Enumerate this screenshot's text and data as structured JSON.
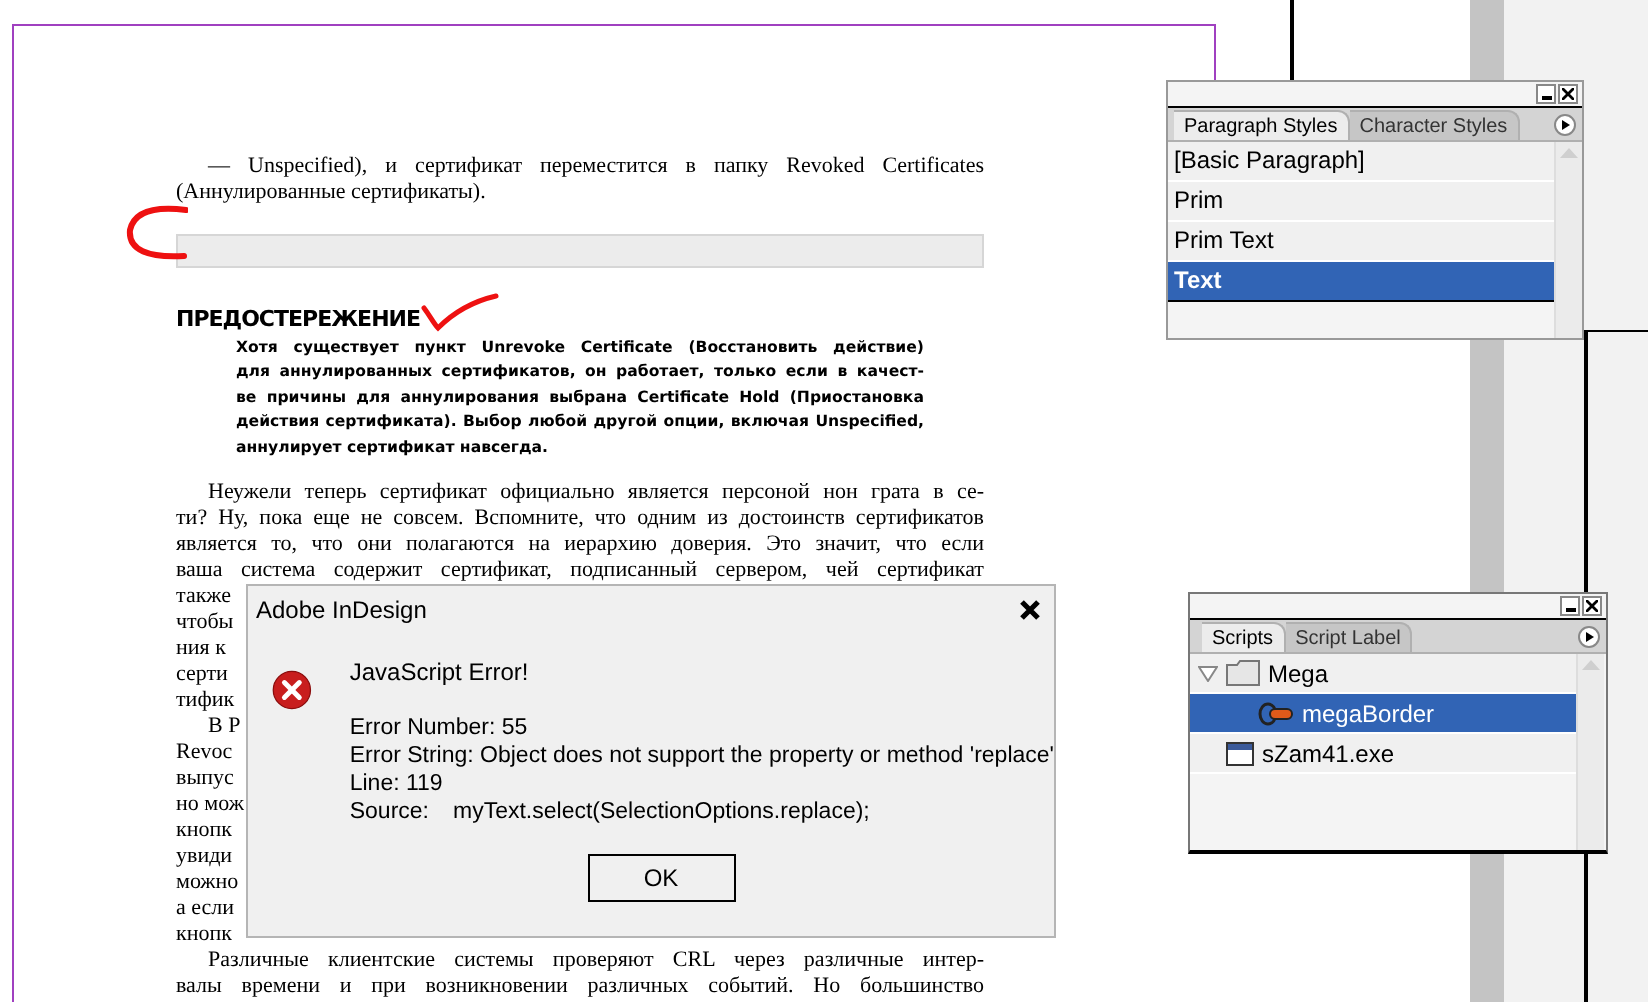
{
  "document": {
    "paragraphs": [
      {
        "kind": "body",
        "lines": [
          {
            "text": "— Unspecified), и сертификат переместится в папку Revoked Certificates",
            "cut": false
          },
          {
            "text": "(Аннулированные сертификаты).",
            "cut": true
          }
        ]
      },
      {
        "kind": "box"
      },
      {
        "kind": "heading",
        "text": "ПРЕДОСТЕРЕЖЕНИЕ"
      },
      {
        "kind": "note",
        "lines": [
          {
            "text": "Хотя существует пункт Unrevoke Certificate (Восстановить действие)",
            "cut": false
          },
          {
            "text": "для аннулированных сертификатов, он работает, только если в качест-",
            "cut": false
          },
          {
            "text": "ве причины для аннулирования выбрана Certificate Hold (Приостановка",
            "cut": false
          },
          {
            "text": "действия сертификата). Выбор любой другой опции, включая Unspecified,",
            "cut": false
          },
          {
            "text": "аннулирует сертификат навсегда.",
            "cut": true
          }
        ]
      },
      {
        "kind": "body",
        "lines": [
          {
            "text": "Неужели теперь сертификат официально является персоной нон грата в се-",
            "cut": false
          },
          {
            "text": "ти? Ну, пока еще не совсем. Вспомните, что одним из достоинств сертификатов",
            "cut": false
          },
          {
            "text": "является то, что они полагаются на иерархию доверия. Это значит, что если",
            "cut": false
          },
          {
            "text": "ваша система содержит сертификат, подписанный сервером, чей сертификат",
            "cut": false
          },
          {
            "text": "также",
            "cut": true
          },
          {
            "text": "чтобы",
            "cut": true
          },
          {
            "text": "ния к",
            "cut": true
          },
          {
            "text": "серти",
            "cut": true
          },
          {
            "text": "тифик",
            "cut": true
          }
        ]
      },
      {
        "kind": "body",
        "lines": [
          {
            "text": "В Р",
            "cut": true
          },
          {
            "text": "Revoc",
            "cut": true
          },
          {
            "text": "выпус",
            "cut": true
          },
          {
            "text": "но мож",
            "cut": true
          },
          {
            "text": "кнопк",
            "cut": true
          },
          {
            "text": "увиди",
            "cut": true
          },
          {
            "text": "можно",
            "cut": true
          },
          {
            "text": "а если",
            "cut": true
          },
          {
            "text": "кнопк",
            "cut": true
          }
        ]
      },
      {
        "kind": "body",
        "lines": [
          {
            "text": "Различные клиентские системы проверяют CRL через различные интер-",
            "cut": false
          },
          {
            "text": "валы времени и при возникновении различных событий. Но большинство",
            "cut": false
          }
        ]
      }
    ]
  },
  "paragraph_styles_panel": {
    "tabs": [
      {
        "label": "Paragraph Styles",
        "selected": true
      },
      {
        "label": "Character Styles",
        "selected": false
      }
    ],
    "items": [
      {
        "label": "[Basic Paragraph]",
        "selected": false
      },
      {
        "label": "Prim",
        "selected": false
      },
      {
        "label": "Prim Text",
        "selected": false
      },
      {
        "label": "Text",
        "selected": true
      }
    ]
  },
  "scripts_panel": {
    "tabs": [
      {
        "label": "Scripts",
        "selected": true
      },
      {
        "label": "Script Label",
        "selected": false
      }
    ],
    "tree": [
      {
        "label": "Mega",
        "kind": "folder",
        "expanded": true,
        "selected": false,
        "children": [
          {
            "label": "megaBorder",
            "kind": "script",
            "selected": true
          }
        ]
      },
      {
        "label": "sZam41.exe",
        "kind": "app",
        "selected": false
      }
    ]
  },
  "dialog": {
    "title": "Adobe InDesign",
    "heading": "JavaScript Error!",
    "details": [
      "Error Number: 55",
      "Error String: Object does not support the property or method 'replace'",
      "Line: 119"
    ],
    "source": {
      "label": "Source:",
      "value": "myText.select(SelectionOptions.replace);"
    },
    "button": "OK"
  }
}
